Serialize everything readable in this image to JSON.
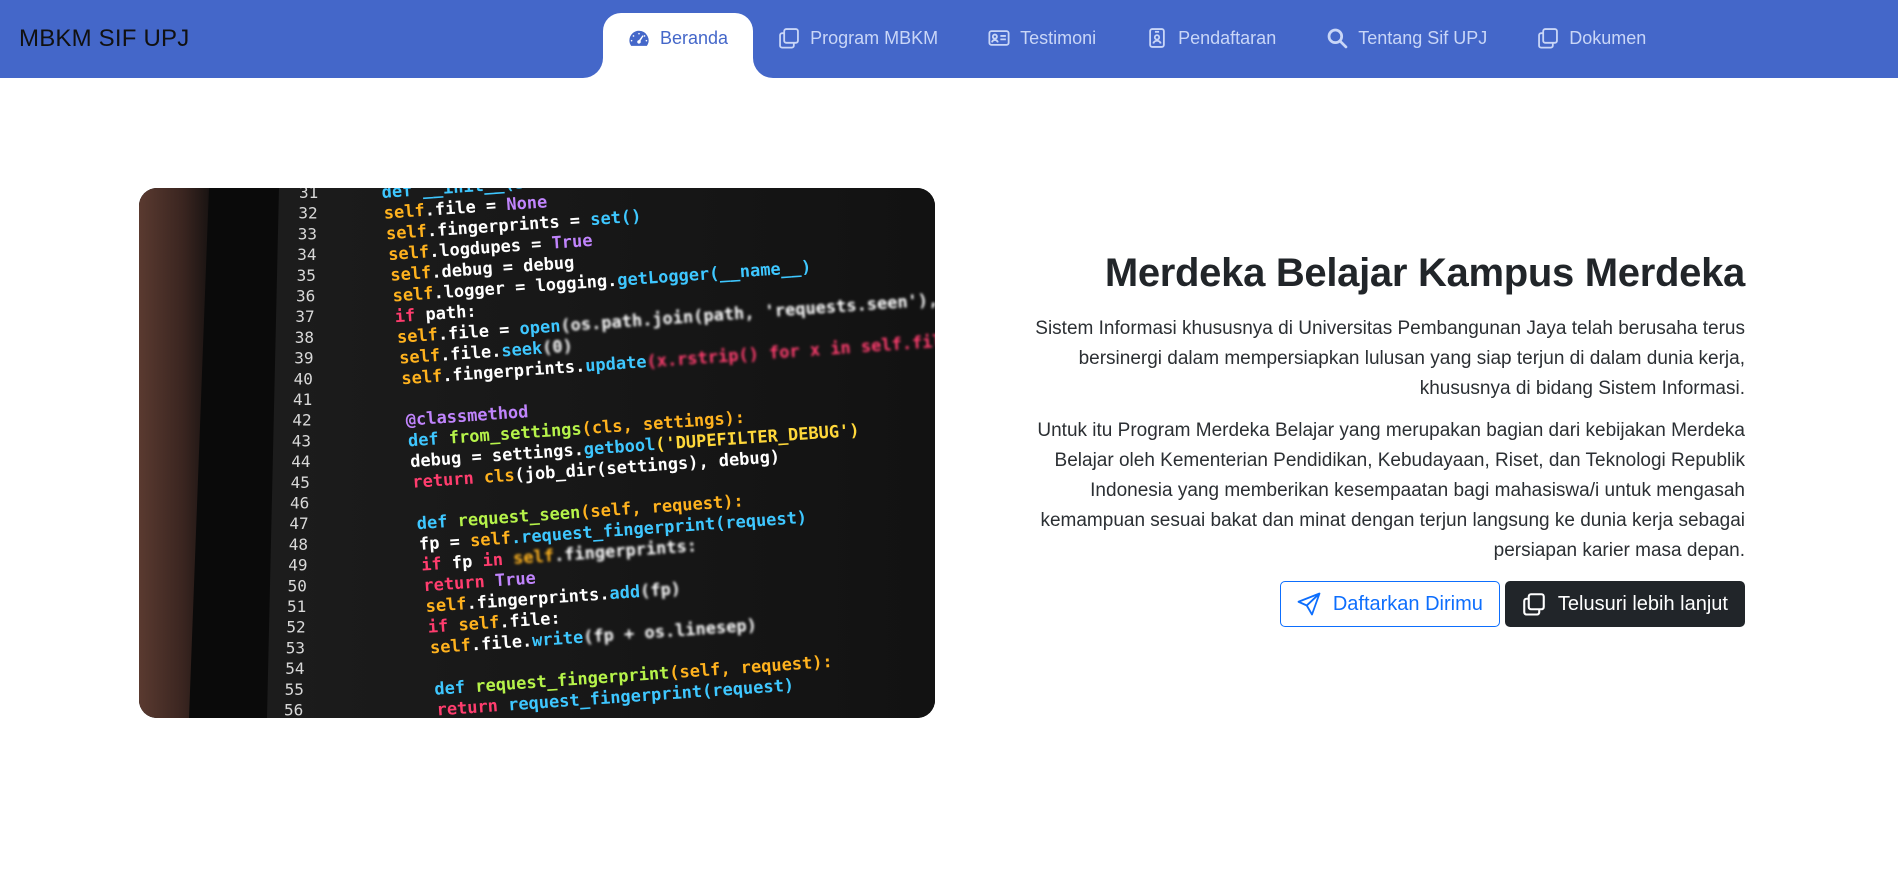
{
  "brand": "MBKM SIF UPJ",
  "nav": {
    "items": [
      {
        "label": "Beranda",
        "icon": "speedometer-icon"
      },
      {
        "label": "Program MBKM",
        "icon": "copy-icon"
      },
      {
        "label": "Testimoni",
        "icon": "person-card-icon"
      },
      {
        "label": "Pendaftaran",
        "icon": "person-badge-icon"
      },
      {
        "label": "Tentang Sif UPJ",
        "icon": "search-icon"
      },
      {
        "label": "Dokumen",
        "icon": "copy-icon"
      }
    ],
    "active": "Beranda"
  },
  "hero": {
    "image_alt": "code-editor-photo",
    "title": "Merdeka Belajar Kampus Merdeka",
    "paragraph1": "Sistem Informasi khususnya di Universitas Pembangunan Jaya telah berusaha terus bersinergi dalam mempersiapkan lulusan yang siap terjun di dalam dunia kerja, khususnya di bidang Sistem Informasi.",
    "paragraph2": "Untuk itu Program Merdeka Belajar yang merupakan bagian dari kebijakan Merdeka Belajar oleh Kementerian Pendidikan, Kebudayaan, Riset, dan Teknologi Republik Indonesia yang memberikan kesempaatan bagi mahasiswa/i untuk mengasah kemampuan sesuai bakat dan minat dengan terjun langsung ke dunia kerja sebagai persiapan karier masa depan.",
    "buttons": {
      "register": {
        "label": "Daftarkan Dirimu",
        "icon": "send-icon"
      },
      "explore": {
        "label": "Telusuri lebih lanjut",
        "icon": "copy-icon"
      }
    }
  },
  "code_photo": {
    "line_numbers": [
      "31",
      "32",
      "33",
      "34",
      "35",
      "36",
      "37",
      "38",
      "39",
      "40",
      "41",
      "42",
      "43",
      "44",
      "45",
      "46",
      "47",
      "48",
      "49",
      "50",
      "51",
      "52",
      "53",
      "54",
      "55",
      "56"
    ],
    "lines": [
      [
        [
          "def __init__(self, path=None):",
          "#3ec7ff"
        ]
      ],
      [
        [
          "self",
          "#ffb21e"
        ],
        [
          ".file = ",
          "#ffffff"
        ],
        [
          "None",
          "#c084fc"
        ]
      ],
      [
        [
          "self",
          "#ffb21e"
        ],
        [
          ".fingerprints = ",
          "#ffffff"
        ],
        [
          "set()",
          "#3ec7ff"
        ]
      ],
      [
        [
          "self",
          "#ffb21e"
        ],
        [
          ".logdupes = ",
          "#ffffff"
        ],
        [
          "True",
          "#c084fc"
        ]
      ],
      [
        [
          "self",
          "#ffb21e"
        ],
        [
          ".debug = debug",
          "#ffffff"
        ]
      ],
      [
        [
          "self",
          "#ffb21e"
        ],
        [
          ".logger = logging.",
          "#ffffff"
        ],
        [
          "getLogger(__name__)",
          "#3ec7ff"
        ]
      ],
      [
        [
          "if ",
          "#ff3d6e"
        ],
        [
          "path:",
          "#ffffff"
        ]
      ],
      [
        [
          "    self",
          "#ffb21e"
        ],
        [
          ".file = ",
          "#ffffff"
        ],
        [
          "open",
          "#3ec7ff"
        ],
        [
          "(os.path.join(path, 'requests.seen'), 'a+')",
          "#ffffff"
        ]
      ],
      [
        [
          "    self",
          "#ffb21e"
        ],
        [
          ".file.",
          "#ffffff"
        ],
        [
          "seek",
          "#3ec7ff"
        ],
        [
          "(0)",
          "#ffffff"
        ]
      ],
      [
        [
          "    self",
          "#ffb21e"
        ],
        [
          ".fingerprints.",
          "#ffffff"
        ],
        [
          "update",
          "#3ec7ff"
        ],
        [
          "(x.rstrip() for x in self.file)",
          "#ff3d6e"
        ]
      ],
      [
        [
          "",
          "#ffffff"
        ]
      ],
      [
        [
          "@classmethod",
          "#c084fc"
        ]
      ],
      [
        [
          "def ",
          "#3ec7ff"
        ],
        [
          "from_settings",
          "#b6f34a"
        ],
        [
          "(cls, settings):",
          "#ffb21e"
        ]
      ],
      [
        [
          "    debug = settings.",
          "#ffffff"
        ],
        [
          "getbool",
          "#3ec7ff"
        ],
        [
          "('DUPEFILTER_DEBUG')",
          "#ffd83a"
        ]
      ],
      [
        [
          "    return ",
          "#ff3d6e"
        ],
        [
          "cls",
          "#ffb21e"
        ],
        [
          "(job_dir(settings), debug)",
          "#ffffff"
        ]
      ],
      [
        [
          "",
          "#ffffff"
        ]
      ],
      [
        [
          "def ",
          "#3ec7ff"
        ],
        [
          "request_seen",
          "#b6f34a"
        ],
        [
          "(self, request):",
          "#ffb21e"
        ]
      ],
      [
        [
          "    fp = ",
          "#ffffff"
        ],
        [
          "self",
          "#ffb21e"
        ],
        [
          ".request_fingerprint(request)",
          "#3ec7ff"
        ]
      ],
      [
        [
          "    if ",
          "#ff3d6e"
        ],
        [
          "fp ",
          "#ffffff"
        ],
        [
          "in ",
          "#ff3d6e"
        ],
        [
          "self",
          "#ffb21e"
        ],
        [
          ".fingerprints:",
          "#ffffff"
        ]
      ],
      [
        [
          "        return ",
          "#ff3d6e"
        ],
        [
          "True",
          "#c084fc"
        ]
      ],
      [
        [
          "    self",
          "#ffb21e"
        ],
        [
          ".fingerprints.",
          "#ffffff"
        ],
        [
          "add",
          "#3ec7ff"
        ],
        [
          "(fp)",
          "#ffffff"
        ]
      ],
      [
        [
          "    if ",
          "#ff3d6e"
        ],
        [
          "self",
          "#ffb21e"
        ],
        [
          ".file:",
          "#ffffff"
        ]
      ],
      [
        [
          "        self",
          "#ffb21e"
        ],
        [
          ".file.",
          "#ffffff"
        ],
        [
          "write",
          "#3ec7ff"
        ],
        [
          "(fp + os.linesep)",
          "#ffffff"
        ]
      ],
      [
        [
          "",
          "#ffffff"
        ]
      ],
      [
        [
          "def ",
          "#3ec7ff"
        ],
        [
          "request_fingerprint",
          "#b6f34a"
        ],
        [
          "(self, request):",
          "#ffb21e"
        ]
      ],
      [
        [
          "    return ",
          "#ff3d6e"
        ],
        [
          "request_fingerprint(request)",
          "#3ec7ff"
        ]
      ]
    ]
  },
  "colors": {
    "navbar": "#4467c9",
    "nav_text": "#c9d6f7",
    "primary": "#0d6efd",
    "dark": "#212529"
  }
}
